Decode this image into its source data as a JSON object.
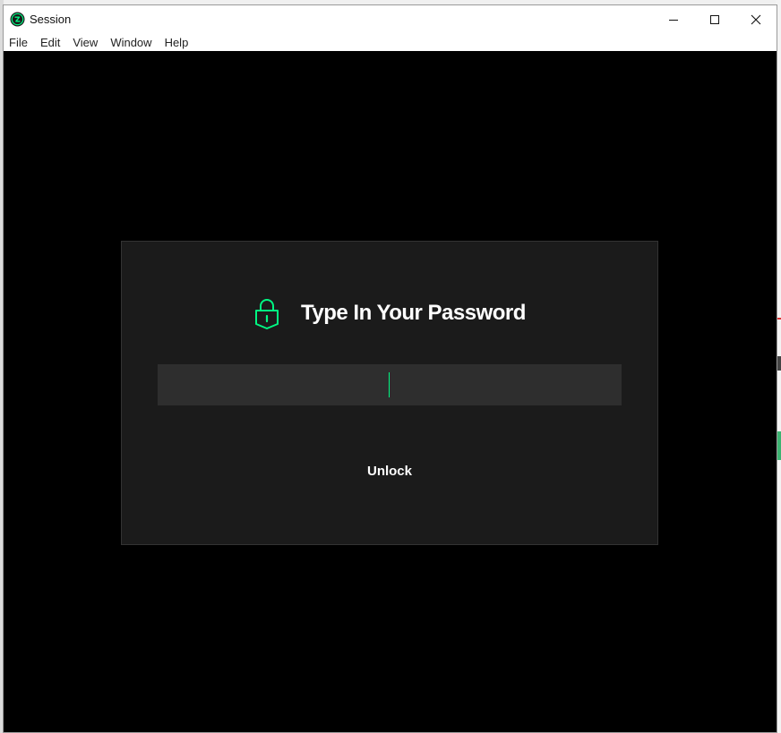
{
  "window": {
    "title": "Session",
    "controls": {
      "minimize_icon": "minimize-icon",
      "maximize_icon": "maximize-icon",
      "close_icon": "close-icon"
    }
  },
  "menu": {
    "items": [
      {
        "label": "File"
      },
      {
        "label": "Edit"
      },
      {
        "label": "View"
      },
      {
        "label": "Window"
      },
      {
        "label": "Help"
      }
    ]
  },
  "dialog": {
    "icon": "lock-icon",
    "title": "Type In Your Password",
    "password": {
      "value": "",
      "placeholder": ""
    },
    "unlock_label": "Unlock"
  },
  "colors": {
    "accent": "#00f782",
    "background": "#000000",
    "dialog_bg": "#1b1b1b",
    "input_bg": "#2e2e2e",
    "text": "#ffffff"
  }
}
